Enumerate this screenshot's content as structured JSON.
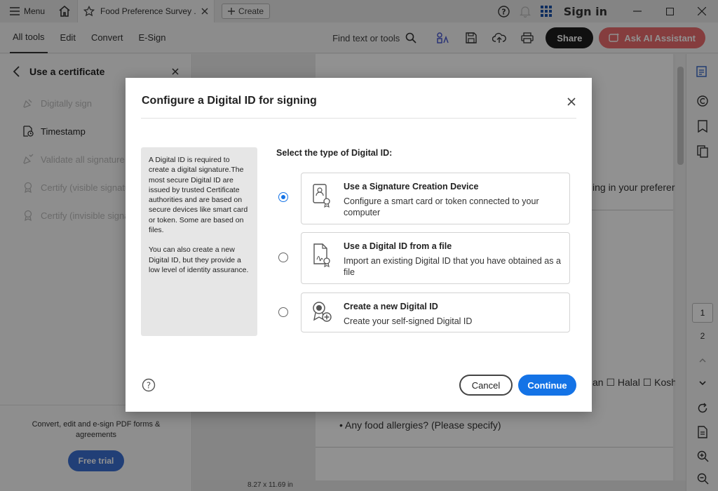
{
  "titlebar": {
    "menu_label": "Menu",
    "tab_title": "Food Preference Survey ...",
    "create_label": "Create",
    "signin_label": "Sign in"
  },
  "toolbar": {
    "tabs": [
      "All tools",
      "Edit",
      "Convert",
      "E-Sign"
    ],
    "find_label": "Find text or tools",
    "share_label": "Share",
    "ai_label": "Ask AI Assistant"
  },
  "leftpanel": {
    "title": "Use a certificate",
    "items": [
      {
        "label": "Digitally sign",
        "enabled": false
      },
      {
        "label": "Timestamp",
        "enabled": true
      },
      {
        "label": "Validate all signature",
        "enabled": false
      },
      {
        "label": "Certify (visible signature)",
        "enabled": false
      },
      {
        "label": "Certify (invisible signature)",
        "enabled": false
      }
    ],
    "footer_text": "Convert, edit and e-sign PDF forms & agreements",
    "trial_label": "Free trial"
  },
  "document": {
    "line1": "ing in your preferer",
    "line2": "an ☐ Halal ☐ Koshe",
    "line3": "• Any food allergies? (Please specify)",
    "page_size": "8.27 x 11.69 in"
  },
  "rightrail": {
    "current_page": "1",
    "next_page": "2"
  },
  "dialog": {
    "title": "Configure a Digital ID for signing",
    "info_p1": "A Digital ID is required to create a digital signature.The most secure Digital ID are issued by trusted Certificate authorities and are based on secure devices like smart card or token. Some are based on files.",
    "info_p2": "You can also create a new Digital ID, but they provide a low level of identity assurance.",
    "select_label": "Select the type of Digital ID:",
    "options": [
      {
        "title": "Use a Signature Creation Device",
        "desc": "Configure a smart card or token connected to your computer",
        "selected": true
      },
      {
        "title": "Use a Digital ID from a file",
        "desc": "Import an existing Digital ID that you have obtained as a file",
        "selected": false
      },
      {
        "title": "Create a new Digital ID",
        "desc": "Create your self-signed Digital ID",
        "selected": false
      }
    ],
    "cancel_label": "Cancel",
    "continue_label": "Continue"
  },
  "colors": {
    "accent": "#1473e6",
    "ai_button": "#ea6b6d",
    "trial_button": "#3b6fd1"
  }
}
